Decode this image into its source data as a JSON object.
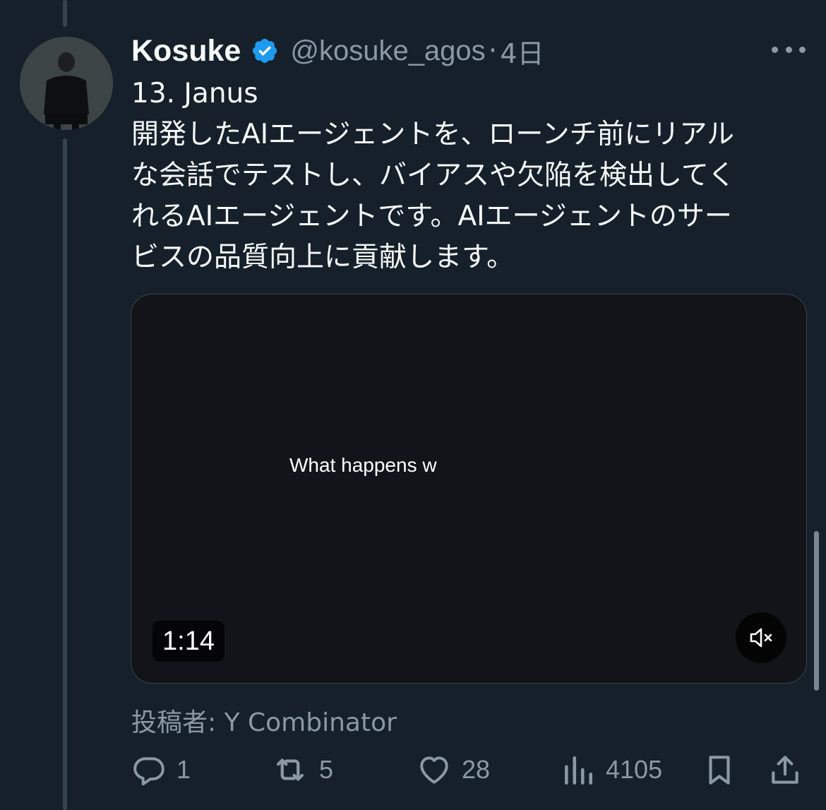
{
  "tweet": {
    "author_name": "Kosuke",
    "handle": "@kosuke_agos",
    "separator": "·",
    "time": "4日",
    "lines": [
      "13. Janus",
      "開発したAIエージェントを、ローンチ前にリアル",
      "な会話でテストし、バイアスや欠陥を検出してく",
      "れるAIエージェントです。AIエージェントのサー",
      "ビスの品質向上に貢献します。"
    ]
  },
  "video": {
    "caption": "What happens w",
    "duration": "1:14"
  },
  "posted_by": "投稿者: Y Combinator",
  "actions": {
    "replies": "1",
    "retweets": "5",
    "likes": "28",
    "views": "4105"
  },
  "icons": {
    "verified": "verified-badge-icon",
    "more": "more-icon",
    "reply": "reply-icon",
    "retweet": "retweet-icon",
    "like": "heart-icon",
    "views": "views-icon",
    "bookmark": "bookmark-icon",
    "share": "share-icon",
    "mute": "mute-icon"
  },
  "colors": {
    "background": "#15202b",
    "verified": "#1d9bf0",
    "muted_text": "#8b98a5"
  }
}
